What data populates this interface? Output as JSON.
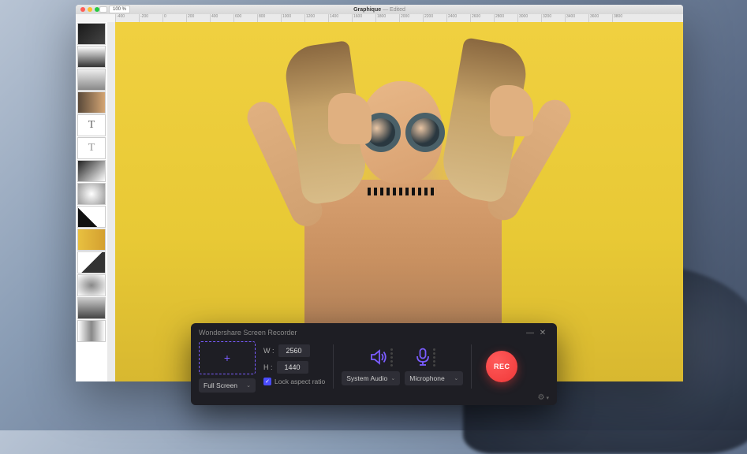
{
  "editor": {
    "title_doc": "Graphique",
    "title_status": "Edited",
    "zoom": "100 %",
    "ruler_ticks": [
      "-400",
      "-200",
      "0",
      "200",
      "400",
      "600",
      "800",
      "1000",
      "1200",
      "1400",
      "1600",
      "1800",
      "2000",
      "2200",
      "2400",
      "2600",
      "2800",
      "3000",
      "3200",
      "3400",
      "3600",
      "3800"
    ],
    "thumb_T": "T"
  },
  "recorder": {
    "title": "Wondershare Screen Recorder",
    "capture_plus": "+",
    "width_label": "W :",
    "width_value": "2560",
    "height_label": "H :",
    "height_value": "1440",
    "preset_label": "Full Screen",
    "lock_aspect_label": "Lock aspect ratio",
    "lock_aspect_checked": true,
    "system_audio_label": "System Audio",
    "microphone_label": "Microphone",
    "rec_label": "REC",
    "minimize_glyph": "—",
    "close_glyph": "✕",
    "checkmark": "✓",
    "chevron": "⌄",
    "gear": "⚙"
  }
}
